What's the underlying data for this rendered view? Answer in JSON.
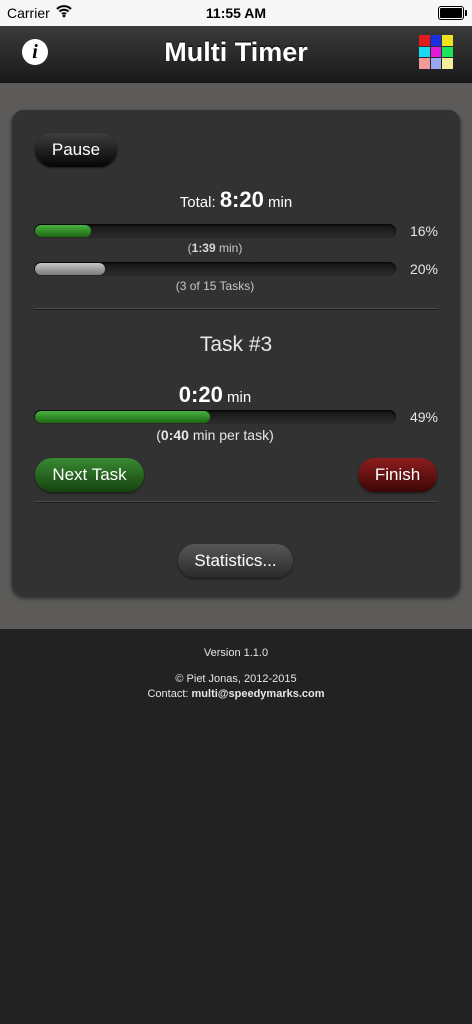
{
  "status_bar": {
    "carrier": "Carrier",
    "time": "11:55 AM"
  },
  "nav": {
    "title": "Multi Timer",
    "info_label": "i",
    "grid_colors": [
      "#e31b1b",
      "#1b2fe3",
      "#f2e21b",
      "#1bd9f2",
      "#e31bd9",
      "#1be35a",
      "#f29a9a",
      "#9aa6f2",
      "#f2ee9a"
    ]
  },
  "timer": {
    "pause_label": "Pause",
    "total_label": "Total:",
    "total_time": "8:20",
    "total_unit": "min",
    "time_progress": 0.16,
    "time_percent": "16%",
    "elapsed_open": "(",
    "elapsed_time": "1:39",
    "elapsed_close": " min)",
    "task_progress": 0.2,
    "task_percent": "20%",
    "tasks_done_text": "(3 of 15 Tasks)"
  },
  "task": {
    "title": "Task #3",
    "time": "0:20",
    "unit": "min",
    "progress": 0.49,
    "percent": "49%",
    "per_task_open": "(",
    "per_task_time": "0:40",
    "per_task_close": " min per task)",
    "next_label": "Next Task",
    "finish_label": "Finish",
    "stats_label": "Statistics..."
  },
  "footer": {
    "version": "Version 1.1.0",
    "copyright": "© Piet Jonas, 2012-2015",
    "contact_label": "Contact:",
    "contact_email": "multi@speedymarks.com"
  }
}
